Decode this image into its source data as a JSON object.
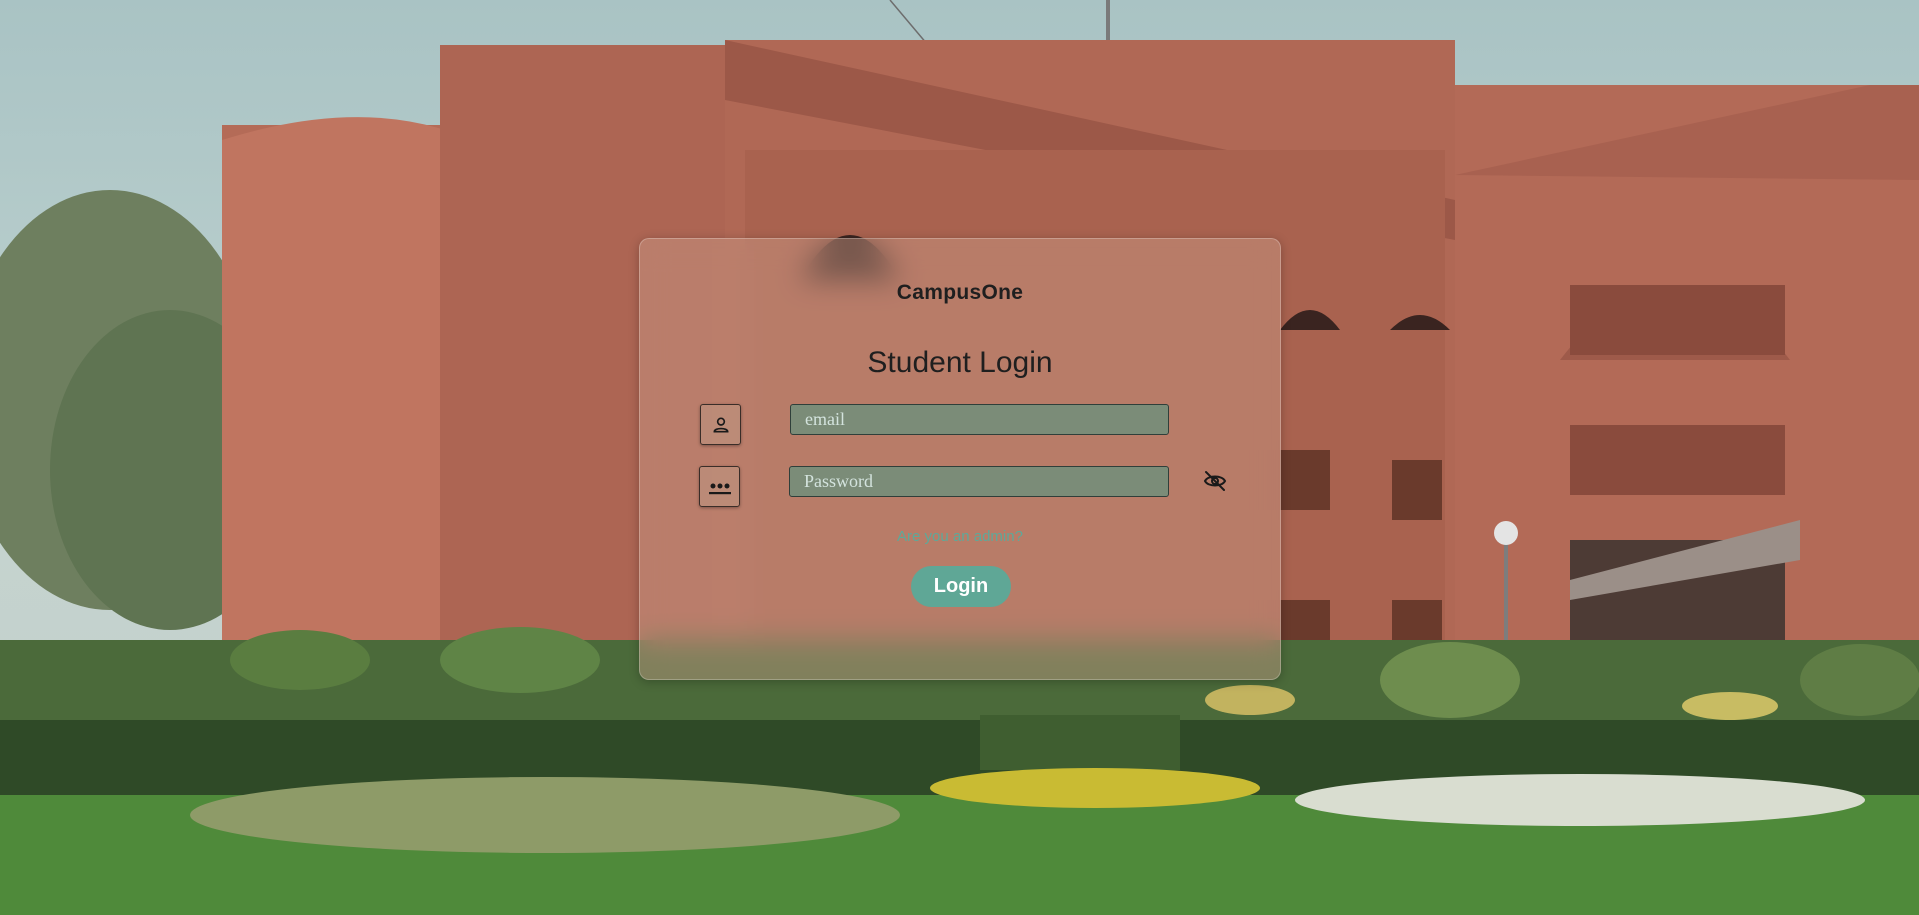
{
  "app": {
    "brand": "CampusOne"
  },
  "login": {
    "title": "Student Login",
    "email_placeholder": "email",
    "password_placeholder": "Password",
    "admin_link": "Are you an admin?",
    "submit_label": "Login"
  },
  "icons": {
    "user": "person-icon",
    "password": "password-dots-icon",
    "toggle_visibility": "eye-slash-icon"
  },
  "colors": {
    "accent": "#5fa796",
    "link": "#5ea999",
    "field_bg": "#56968280",
    "card_tint": "#cda08c"
  }
}
